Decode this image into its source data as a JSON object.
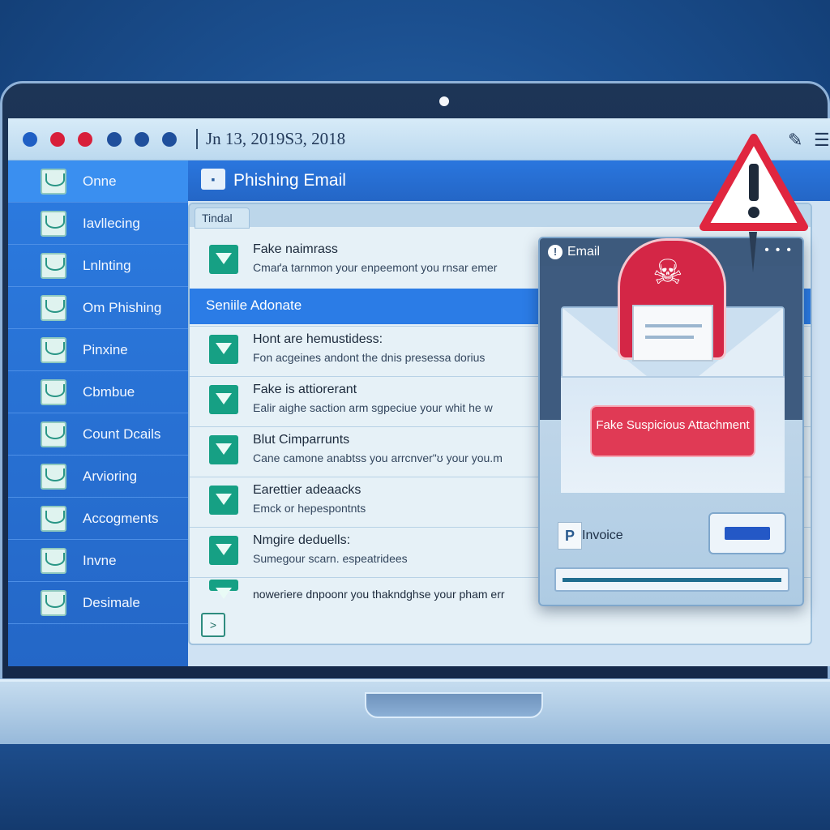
{
  "titlebar": {
    "date": "Jn 13, 2019S3, 2018",
    "dot_colors": [
      "#1f5fc4",
      "#d81f3a",
      "#d81f3a",
      "#1f4f9c",
      "#1f4f9c",
      "#1f4f9c"
    ]
  },
  "sidebar": {
    "items": [
      {
        "label": "Onne"
      },
      {
        "label": "Iavllecing"
      },
      {
        "label": "Lnlnting"
      },
      {
        "label": "Om Phishing"
      },
      {
        "label": "Pinxine"
      },
      {
        "label": "Cbmbue"
      },
      {
        "label": "Count Dcails"
      },
      {
        "label": "Arvioring"
      },
      {
        "label": "Accogments"
      },
      {
        "label": "Invne"
      },
      {
        "label": "Desimale"
      }
    ]
  },
  "header": {
    "title": "Phishing Email"
  },
  "mail_panel": {
    "tab_label": "Tindal",
    "selected_label": "Seniile Adonate",
    "rows": [
      {
        "subject": "Fake naimrass",
        "preview": "Cmaґa tarnmon your enpeemont you rnsar emer"
      },
      {
        "subject": "Hont are hemustidess:",
        "preview": "Fon acgeines andont the dnis presessa dorius"
      },
      {
        "subject": "Fake is attiorerant",
        "preview": "Ealir aighe saction arm sgpeciue your whit he w"
      },
      {
        "subject": "Blut Cimparrunts",
        "preview": "Cane camone anabtss you arrcnver\"ʊ your you.m"
      },
      {
        "subject": "Earettier adeaacks",
        "preview": "Emck or hepespontnts"
      },
      {
        "subject": "Nmgire deduells:",
        "preview": "Sumegour scarn. espeatridees"
      },
      {
        "subject": "",
        "preview": "noweriere dnpoonr you thakndghse your pham err"
      }
    ]
  },
  "popup": {
    "title": "Email",
    "attachment_label": "Fake Suspicious Attachment",
    "invoice_label": "Invoice",
    "attachment_color": "#e03a55"
  },
  "icons": {
    "warning": "warning-triangle-icon",
    "skull": "skull-crossbones-icon",
    "mail": "mail-icon"
  }
}
